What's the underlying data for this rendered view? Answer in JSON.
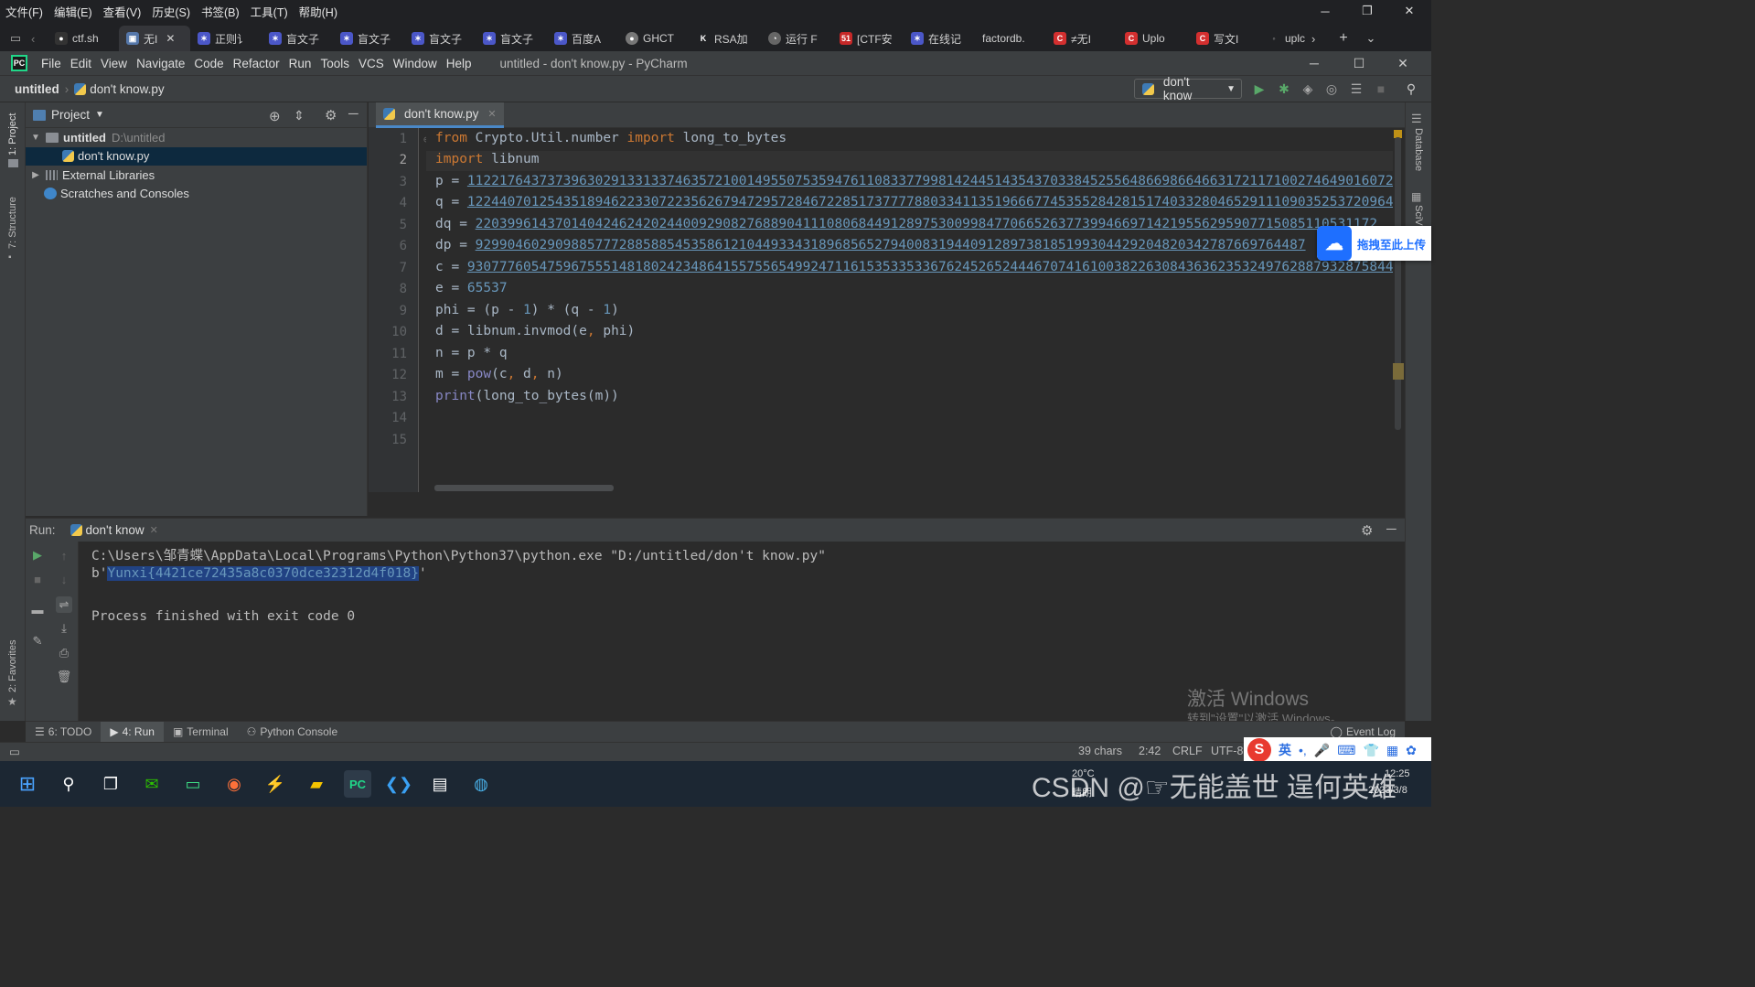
{
  "browser": {
    "menu": [
      "文件(F)",
      "编辑(E)",
      "查看(V)",
      "历史(S)",
      "书签(B)",
      "工具(T)",
      "帮助(H)"
    ],
    "tabs": [
      "ctf.sh",
      "无I",
      "正则讠",
      "盲文子",
      "盲文子",
      "盲文子",
      "盲文子",
      "百度A",
      "GHCT",
      "RSA加",
      "运行 F",
      "[CTF安",
      "在线记",
      "factordb.",
      "≠无I",
      "Uplo",
      "写文I",
      "uplc"
    ],
    "new_tab": "+"
  },
  "ide": {
    "menu": [
      "File",
      "Edit",
      "View",
      "Navigate",
      "Code",
      "Refactor",
      "Run",
      "Tools",
      "VCS",
      "Window",
      "Help"
    ],
    "title": "untitled - don't know.py - PyCharm",
    "breadcrumb": {
      "project": "untitled",
      "file": "don't know.py"
    },
    "run_config": "don't know",
    "left_stripe": {
      "project": "1: Project",
      "structure": "7: Structure",
      "favorites": "2: Favorites"
    },
    "right_stripe": {
      "database": "Database",
      "sciview": "SciView"
    }
  },
  "project_panel": {
    "title": "Project",
    "root": {
      "name": "untitled",
      "path": "D:\\untitled"
    },
    "file": "don't know.py",
    "external": "External Libraries",
    "scratches": "Scratches and Consoles"
  },
  "editor": {
    "tab": "don't know.py",
    "line_numbers": [
      "1",
      "2",
      "3",
      "4",
      "5",
      "6",
      "7",
      "8",
      "9",
      "10",
      "11",
      "12",
      "13",
      "14",
      "15"
    ],
    "line1": {
      "kw1": "from",
      "mod": " Crypto.Util.number ",
      "kw2": "import",
      "name": " long_to_bytes"
    },
    "line2": {
      "kw": "import",
      "name": " libnum"
    },
    "line3": {
      "prefix": "p = ",
      "value": "11221764373739630291331337463572100149550753594761108337799814244514354370338452556486698664663172117100274649016072"
    },
    "line4": {
      "prefix": "q = ",
      "value": "12244070125435189462233072235626794729572846722851737777880334113519666774535528428151740332804652911109035253720964"
    },
    "line5": {
      "prefix": "dq = ",
      "value": "22039961437014042462420244009290827688904111080684491289753009984770665263773994669714219556295907715085110531172"
    },
    "line6": {
      "prefix": "dp = ",
      "value": "92990460290988577728858854535861210449334318968565279400831944091289738185199304429204820342787669764487"
    },
    "line7": {
      "prefix": "c = ",
      "value": "93077760547596755514818024234864155755654992471161535335336762452652444670741610038226308436362353249762887932875844"
    },
    "line8": {
      "prefix": "e = ",
      "value": "65537"
    },
    "line9": {
      "a": "phi = (p - ",
      "n1": "1",
      "b": ") * (q - ",
      "n2": "1",
      "c": ")"
    },
    "line10": {
      "a": "d = libnum.invmod(e",
      "comma": ",",
      "b": " phi)"
    },
    "line11": "n = p * q",
    "line12": {
      "a": "m = ",
      "fn": "pow",
      "b": "(c",
      "c1": ",",
      "d": " d",
      "c2": ",",
      "e": " n)"
    },
    "line13": {
      "fn": "print",
      "rest": "(long_to_bytes(m))"
    }
  },
  "upload_widget": {
    "label": "拖拽至此上传"
  },
  "run_panel": {
    "label": "Run:",
    "tab": "don't know",
    "cmd": "C:\\Users\\邹青蝶\\AppData\\Local\\Programs\\Python\\Python37\\python.exe \"D:/untitled/don't know.py\"",
    "out_prefix": "b'",
    "out_flag": "Yunxi{4421ce72435a8c0370dce32312d4f018}",
    "out_suffix": "'",
    "finished": "Process finished with exit code 0"
  },
  "bottom_tabs": [
    "6: TODO",
    "4: Run",
    "Terminal",
    "Python Console"
  ],
  "event_log": "Event Log",
  "status": {
    "chars": "39 chars",
    "pos": "2:42",
    "eol": "CRLF",
    "enc": "UTF-8"
  },
  "watermark": {
    "line1": "激活 Windows",
    "line2": "转到\"设置\"以激活 Windows。"
  },
  "overlay_text": "CSDN @☞无能盖世 逞何英雄",
  "ime": {
    "lang": "英"
  },
  "tray": {
    "weather": "20°C",
    "weather_desc": "晴朗",
    "time": "12:25",
    "date": "2023/3/8"
  },
  "colors": {
    "ide_bg": "#2b2b2b",
    "panel_bg": "#3c3f41",
    "keyword": "#cc7832",
    "number": "#6897bb",
    "builtin": "#8888c6",
    "selection": "#214283"
  }
}
